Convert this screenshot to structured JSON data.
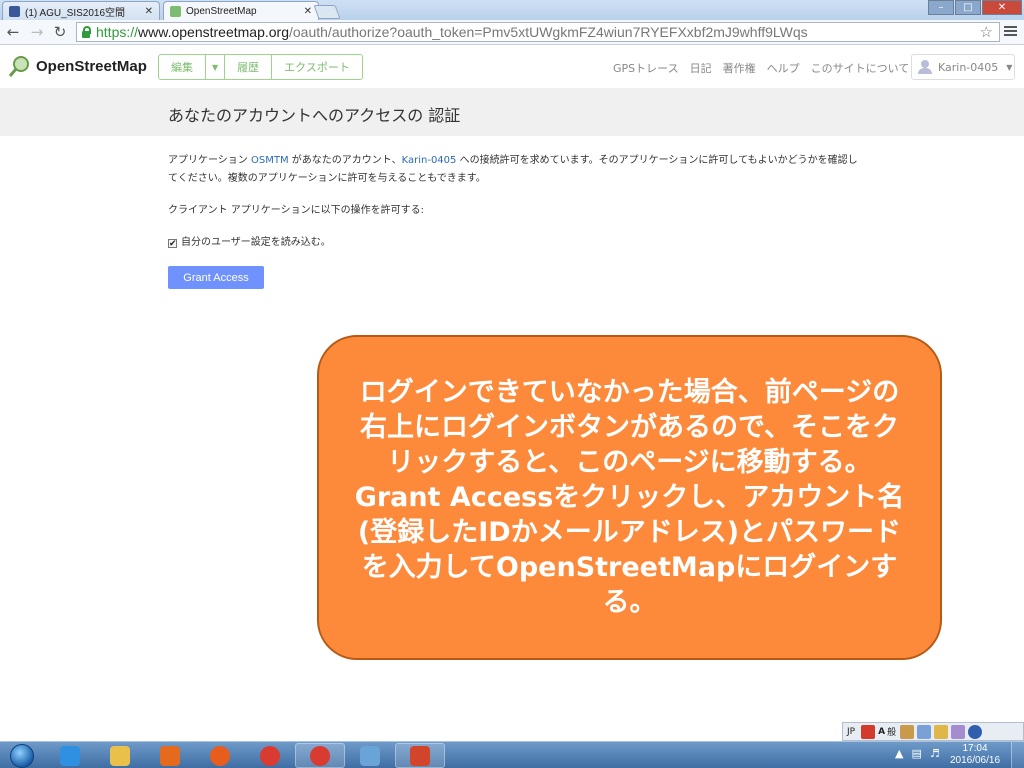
{
  "browser": {
    "tabs": [
      {
        "title": "(1) AGU_SIS2016空間",
        "active": false,
        "favicon": "facebook-icon",
        "color": "#3b5998"
      },
      {
        "title": "OpenStreetMap",
        "active": true,
        "favicon": "osm-icon",
        "color": "#7ebc6f"
      }
    ],
    "close_glyph": "✕",
    "url": {
      "scheme": "https://",
      "host": "www.openstreetmap.org",
      "path": "/oauth/authorize?oauth_token=Pmv5xtUWgkmFZ4wiun7RYEFXxbf2mJ9whff9LWqs"
    },
    "window_controls": [
      "–",
      "□",
      "✕"
    ]
  },
  "osm": {
    "logo_text": "OpenStreetMap",
    "edit_buttons": [
      "編集",
      "履歴",
      "エクスポート"
    ],
    "nav": [
      "GPSトレース",
      "日記",
      "著作権",
      "ヘルプ",
      "このサイトについて"
    ],
    "user": "Karin-0405"
  },
  "page": {
    "title": "あなたのアカウントへのアクセスの 認証",
    "para1_a": "アプリケーション",
    "app_name": "OSMTM",
    "para1_b": "があなたのアカウント、",
    "account": "Karin-0405",
    "para1_c": "への接続許可を求めています。そのアプリケーションに許可してもよいかどうかを確認してください。複数のアプリケーションに許可を与えることもできます。",
    "permission_heading": "クライアント アプリケーションに以下の操作を許可する:",
    "permission_item": "自分のユーザー設定を読み込む。",
    "permission_checked": true,
    "grant_button": "Grant Access"
  },
  "callout": {
    "text": "ログインできていなかった場合、前ページの右上にログインボタンがあるので、そこをクリックすると、このページに移動する。Grant Accessをクリックし、アカウント名(登録したIDかメールアドレス)とパスワードを入力してOpenStreetMapにログインする。",
    "color": "#fd8a3b"
  },
  "langbar": {
    "lang": "JP",
    "ime_mode": "A",
    "ime_label": "般"
  },
  "taskbar": {
    "apps": [
      {
        "name": "internet-explorer-icon",
        "color": "#2f8fe0",
        "open": false
      },
      {
        "name": "file-explorer-icon",
        "color": "#e8c04a",
        "open": false
      },
      {
        "name": "media-player-icon",
        "color": "#e66a1e",
        "open": false
      },
      {
        "name": "firefox-icon",
        "color": "#e85d1c",
        "open": false
      },
      {
        "name": "chrome-icon",
        "color": "#d93b30",
        "open": false
      },
      {
        "name": "chrome-icon-2",
        "color": "#d93b30",
        "open": true
      },
      {
        "name": "paint-icon",
        "color": "#6aa3d8",
        "open": false
      },
      {
        "name": "powerpoint-icon",
        "color": "#d2452a",
        "open": true
      }
    ],
    "time": "17:04",
    "date": "2016/06/16"
  }
}
